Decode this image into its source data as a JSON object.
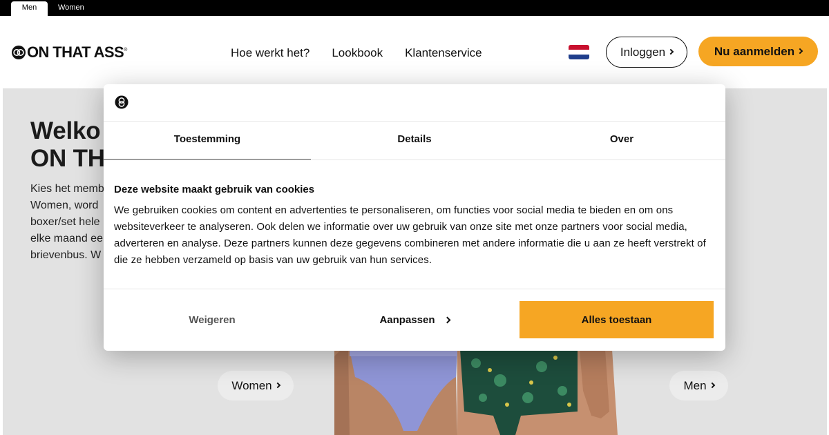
{
  "gender_tabs": {
    "men": "Men",
    "women": "Women"
  },
  "brand": {
    "name": "ON THAT ASS",
    "registered": "®"
  },
  "nav": {
    "items": [
      "Hoe werkt het?",
      "Lookbook",
      "Klantenservice"
    ]
  },
  "header": {
    "login_label": "Inloggen",
    "signup_label": "Nu aanmelden",
    "flag": "netherlands-flag-icon"
  },
  "hero": {
    "title_line1": "Welko",
    "title_line2": "ON TH",
    "text_lines": [
      "Kies het memb",
      "Women, word",
      "boxer/set hele",
      "elke maand ee",
      "brievenbus. W"
    ],
    "women_label": "Women",
    "men_label": "Men"
  },
  "cookie_dialog": {
    "tabs": [
      "Toestemming",
      "Details",
      "Over"
    ],
    "heading": "Deze website maakt gebruik van cookies",
    "body": "We gebruiken cookies om content en advertenties te personaliseren, om functies voor social media te bieden en om ons websiteverkeer te analyseren. Ook delen we informatie over uw gebruik van onze site met onze partners voor social media, adverteren en analyse. Deze partners kunnen deze gegevens combineren met andere informatie die u aan ze heeft verstrekt of die ze hebben verzameld op basis van uw gebruik van hun services.",
    "deny_label": "Weigeren",
    "customize_label": "Aanpassen",
    "allow_label": "Alles toestaan"
  },
  "colors": {
    "accent": "#f6a623",
    "text": "#111111",
    "hero_bg": "#e2e2e2"
  }
}
